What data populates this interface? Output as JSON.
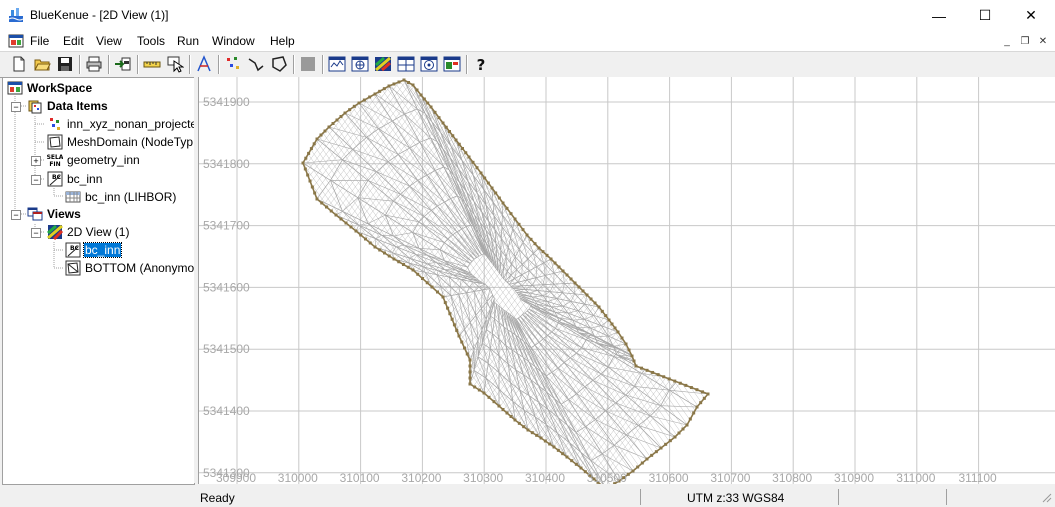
{
  "window": {
    "title": "BlueKenue - [2D View (1)]",
    "minimize_glyph": "—",
    "maximize_glyph": "☐",
    "close_glyph": "✕"
  },
  "menu": {
    "items": [
      "File",
      "Edit",
      "View",
      "Tools",
      "Run",
      "Window",
      "Help"
    ],
    "mdi_minimize": "_",
    "mdi_restore": "❐",
    "mdi_close": "✕"
  },
  "tree": {
    "workspace": "WorkSpace",
    "data_items": "Data Items",
    "item_xyz": "inn_xyz_nonan_projecte",
    "item_mesh": "MeshDomain (NodeTyp",
    "item_geometry": "geometry_inn",
    "item_bc": "bc_inn",
    "item_bc_child": "bc_inn (LIHBOR)",
    "views": "Views",
    "view_2d": "2D View (1)",
    "view_bc": "bc_inn",
    "view_bottom": "BOTTOM (Anonymo",
    "collapse_glyph": "−",
    "expand_glyph": "+"
  },
  "scrollbar": {
    "left_arrow": "<",
    "right_arrow": ">"
  },
  "view2d": {
    "y_labels": [
      "5341900",
      "5341800",
      "5341700",
      "5341600",
      "5341500",
      "5341400",
      "5341300"
    ],
    "x_labels": [
      "309900",
      "310000",
      "310100",
      "310200",
      "310300",
      "310400",
      "310500",
      "310600",
      "310700",
      "310800",
      "310900",
      "311000",
      "311100"
    ],
    "grid_color": "#c8c8c8",
    "mesh_color": "#a8a8a8",
    "boundary_color": "#8a7748"
  },
  "status": {
    "ready": "Ready",
    "projection": "UTM z:33 WGS84"
  }
}
